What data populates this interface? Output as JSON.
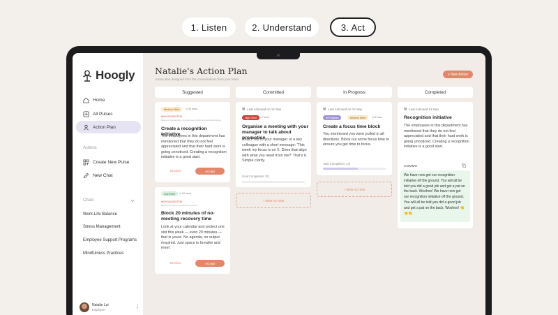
{
  "steps": [
    "1. Listen",
    "2. Understand",
    "3. Act"
  ],
  "sidebar": {
    "app_name": "Hoogly",
    "nav": [
      {
        "label": "Home",
        "icon": "home-icon"
      },
      {
        "label": "All Pulses",
        "icon": "pulses-icon"
      },
      {
        "label": "Action Plan",
        "icon": "action-plan-icon",
        "active": true
      }
    ],
    "actions_header": "Actions",
    "actions": [
      {
        "label": "Create New Pulse",
        "icon": "create-pulse-icon"
      },
      {
        "label": "New Chat",
        "icon": "new-chat-icon"
      }
    ],
    "chats_header": "Chats",
    "chats": [
      "Work-Life Balance",
      "Stress Management",
      "Employee Support Programs",
      "Mindfulness Practices"
    ],
    "user": {
      "name": "Natalie Lui",
      "role": "Employee"
    }
  },
  "main": {
    "title": "Natalie's Action Plan",
    "subtitle": "Action plan designed from the conversations from your team",
    "new_action": "+ New Action",
    "columns": [
      "Suggested",
      "Committed",
      "In Progress",
      "Completed"
    ],
    "suggested": [
      {
        "effort": "Medium Effort",
        "time": "30 mins",
        "flag": "HIGH SUGGESTION",
        "note": "Based on Recognition of employees' efforts and accomplishment",
        "title": "Create a recognition initiative",
        "body": "The employees in this department has mentioned that they do not feel appreciated and that their hard work is going unnoticed. Creating a recognition initiative is a good start.",
        "dismiss": "Dismiss",
        "accept": "Accept"
      },
      {
        "effort": "Low Effort",
        "time": "20 mins",
        "flag": "HIGH SUGGESTION",
        "note": "Based on Lack of recognition by peers",
        "title": "Block 20 minutes of no-meeting recovery time",
        "body": "Look at your calendar and protect one slot this week — even 20 minutes — that is yours. No agenda, no output required. Just space to breathe and reset.",
        "dismiss": "Dismiss",
        "accept": "Accept"
      }
    ],
    "committed": {
      "last": "Last Actioned on 12 Sep",
      "effort": "High Effort",
      "time": "2 mins",
      "title": "Organise a meeting with your manager to talk about promotion",
      "body": "Reach out to your manager or a key colleague with a short message: 'This week my focus is on X. Does that align with what you need from me?' That's it. Simple clarity.",
      "progress_label": "Goal Completion: 0/1",
      "progress": 0,
      "new_action": "+ NEW ACTION"
    },
    "in_progress": {
      "last": "Last Actioned on 12 Sep",
      "tag1": "In Progress",
      "tag2": "Medium Effort",
      "time": "3 mins",
      "title": "Create a focus time block",
      "body": "You mentioned you were pulled in all directions. Block out some focus time to ensure you get time to focus.",
      "progress_label": "Task Completion: 1/3",
      "progress": 0.55,
      "new_action": "+ NEW ACTION"
    },
    "completed": {
      "last": "Last Actioned 12 Sep",
      "title": "Recognition initiative",
      "body": "The employees in this department has mentioned that they do not feel appreciated and that their hard work is going unnoticed. Creating a recognition initiative is a good start.",
      "comms_label": "COMMS",
      "comms_text": "We have now got our recognition initiative off the ground. You will all be told you did a good job and get a pat on the back. Woohoo! We have now got our recognition initiative off the ground. You will all be told you did a good job and get a pat on the back. Woohoo! 👏👏👏"
    }
  },
  "colors": {
    "accent": "#e4866a",
    "active_nav": "#e6e3f3",
    "comms_bg": "#e8f6ec"
  }
}
